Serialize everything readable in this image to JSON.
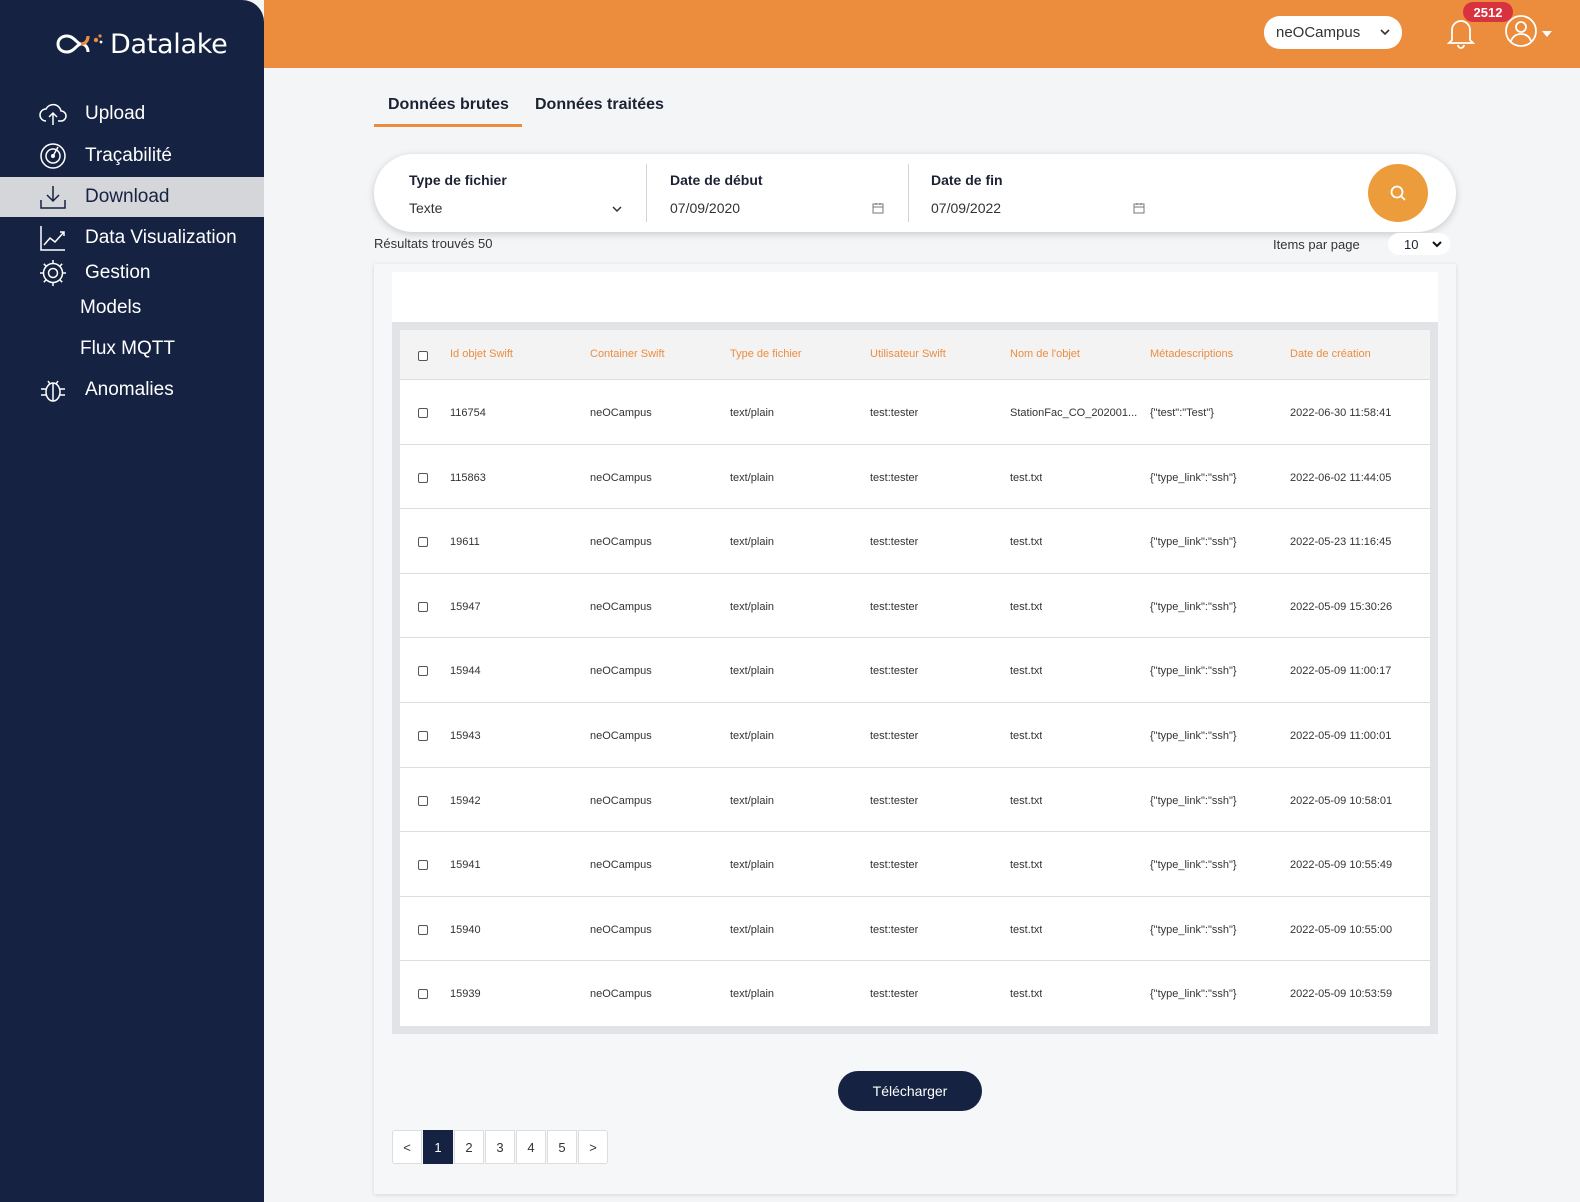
{
  "app": {
    "name": "Datalake"
  },
  "colors": {
    "sidebar": "#152241",
    "accent": "#ec8d3e",
    "badge": "#d9323f",
    "active_nav": "#d4d6da"
  },
  "sidebar": {
    "items": [
      {
        "label": "Upload",
        "icon": "cloud-upload-icon"
      },
      {
        "label": "Traçabilité",
        "icon": "radar-icon"
      },
      {
        "label": "Download",
        "icon": "download-icon",
        "active": true
      },
      {
        "label": "Data Visualization",
        "icon": "chart-line-icon"
      },
      {
        "label": "Gestion",
        "icon": "gear-icon"
      },
      {
        "label": "Anomalies",
        "icon": "bug-icon"
      }
    ],
    "sub_items": [
      "Models",
      "Flux MQTT"
    ]
  },
  "header": {
    "tenant": "neOCampus",
    "notification_count": "2512"
  },
  "tabs": [
    {
      "label": "Données brutes",
      "active": true
    },
    {
      "label": "Données traitées",
      "active": false
    }
  ],
  "filter": {
    "file_type": {
      "label": "Type de fichier",
      "value": "Texte"
    },
    "start_date": {
      "label": "Date de début",
      "value": "07/09/2020"
    },
    "end_date": {
      "label": "Date de fin",
      "value": "07/09/2022"
    }
  },
  "results_text": "Résultats trouvés 50",
  "items_per_page": {
    "label": "Items par page",
    "value": "10"
  },
  "table": {
    "columns": [
      "Id objet Swift",
      "Container Swift",
      "Type de fichier",
      "Utilisateur Swift",
      "Nom de l'objet",
      "Métadescriptions",
      "Date de création"
    ],
    "rows": [
      [
        "116754",
        "neOCampus",
        "text/plain",
        "test:tester",
        "StationFac_CO_202001...",
        "{\"test\":\"Test\"}",
        "2022-06-30 11:58:41"
      ],
      [
        "115863",
        "neOCampus",
        "text/plain",
        "test:tester",
        "test.txt",
        "{\"type_link\":\"ssh\"}",
        "2022-06-02 11:44:05"
      ],
      [
        "19611",
        "neOCampus",
        "text/plain",
        "test:tester",
        "test.txt",
        "{\"type_link\":\"ssh\"}",
        "2022-05-23 11:16:45"
      ],
      [
        "15947",
        "neOCampus",
        "text/plain",
        "test:tester",
        "test.txt",
        "{\"type_link\":\"ssh\"}",
        "2022-05-09 15:30:26"
      ],
      [
        "15944",
        "neOCampus",
        "text/plain",
        "test:tester",
        "test.txt",
        "{\"type_link\":\"ssh\"}",
        "2022-05-09 11:00:17"
      ],
      [
        "15943",
        "neOCampus",
        "text/plain",
        "test:tester",
        "test.txt",
        "{\"type_link\":\"ssh\"}",
        "2022-05-09 11:00:01"
      ],
      [
        "15942",
        "neOCampus",
        "text/plain",
        "test:tester",
        "test.txt",
        "{\"type_link\":\"ssh\"}",
        "2022-05-09 10:58:01"
      ],
      [
        "15941",
        "neOCampus",
        "text/plain",
        "test:tester",
        "test.txt",
        "{\"type_link\":\"ssh\"}",
        "2022-05-09 10:55:49"
      ],
      [
        "15940",
        "neOCampus",
        "text/plain",
        "test:tester",
        "test.txt",
        "{\"type_link\":\"ssh\"}",
        "2022-05-09 10:55:00"
      ],
      [
        "15939",
        "neOCampus",
        "text/plain",
        "test:tester",
        "test.txt",
        "{\"type_link\":\"ssh\"}",
        "2022-05-09 10:53:59"
      ]
    ]
  },
  "download_button": "Télécharger",
  "pagination": {
    "prev": "<",
    "next": ">",
    "pages": [
      "1",
      "2",
      "3",
      "4",
      "5"
    ],
    "current": "1"
  }
}
